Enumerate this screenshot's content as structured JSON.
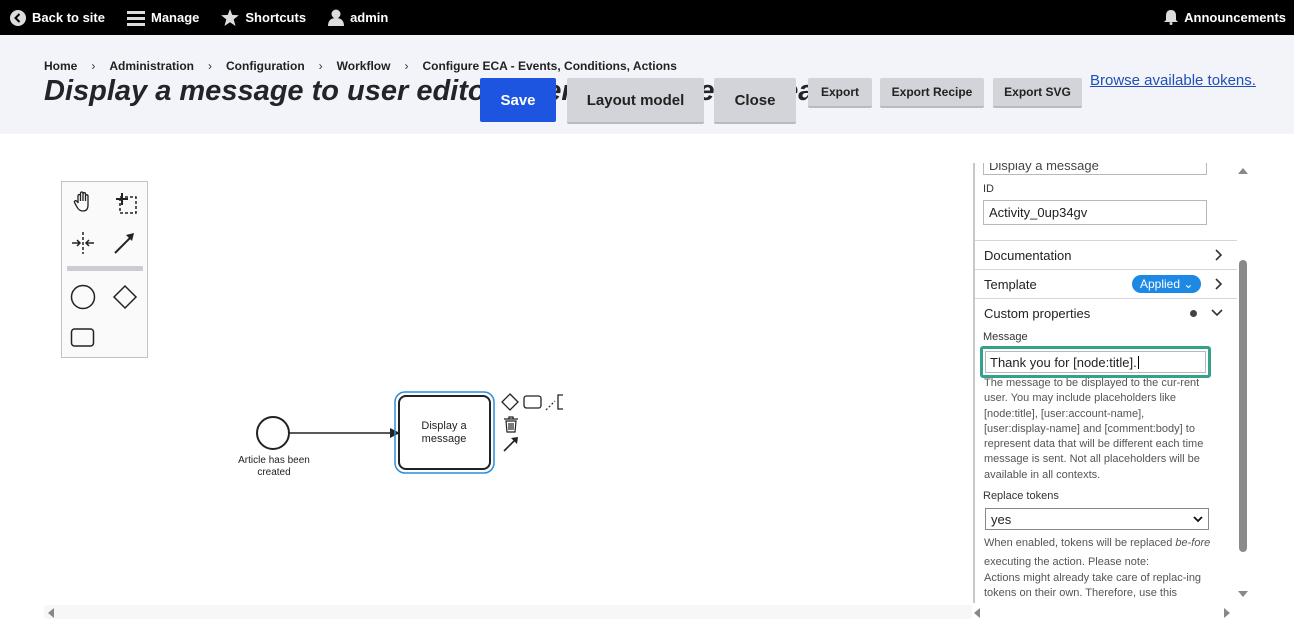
{
  "toolbar": {
    "back": "Back to site",
    "manage": "Manage",
    "shortcuts": "Shortcuts",
    "user": "admin",
    "announcements": "Announcements"
  },
  "breadcrumb": [
    "Home",
    "Administration",
    "Configuration",
    "Workflow",
    "Configure ECA - Events, Conditions, Actions"
  ],
  "page_title": "Display a message to user editor when an article is created",
  "buttons": {
    "save": "Save",
    "layout": "Layout model",
    "close": "Close",
    "export": "Export",
    "export_recipe": "Export Recipe",
    "export_svg": "Export SVG"
  },
  "browse_tokens": "Browse available tokens.",
  "palette": {
    "tools": [
      "hand-tool-icon",
      "lasso-tool-icon",
      "space-tool-icon",
      "connect-tool-icon",
      "start-event-icon",
      "gateway-icon",
      "task-icon"
    ]
  },
  "diagram": {
    "start_event_label": "Article has been created",
    "task_label": "Display a message"
  },
  "properties": {
    "name_value": "Display a message",
    "id_label": "ID",
    "id_value": "Activity_0up34gv",
    "documentation": "Documentation",
    "template": "Template",
    "template_badge": "Applied",
    "custom_properties": "Custom properties",
    "message_label": "Message",
    "message_value": "Thank you for [node:title].",
    "message_desc": "The message to be displayed to the cur-rent user. You may include placeholders like [node:title], [user:account-name], [user:display-name] and [comment:body] to represent data that will be different each time message is sent. Not all placeholders will be available in all contexts.",
    "replace_label": "Replace tokens",
    "replace_value": "yes",
    "replace_desc_1": "When enabled, tokens will be replaced",
    "replace_desc_em": "be-fore",
    "replace_desc_2": "executing the action. Please note:",
    "replace_desc_3": "Actions might already take care of replac-ing tokens on their own. Therefore, use this"
  },
  "colors": {
    "toolbar_bg": "#000000",
    "header_bg": "#f3f4f9",
    "save_bg": "#1d55e0",
    "badge_bg": "#1e88e5",
    "focus_border": "#36a18b",
    "selection": "#2a8ddb"
  }
}
